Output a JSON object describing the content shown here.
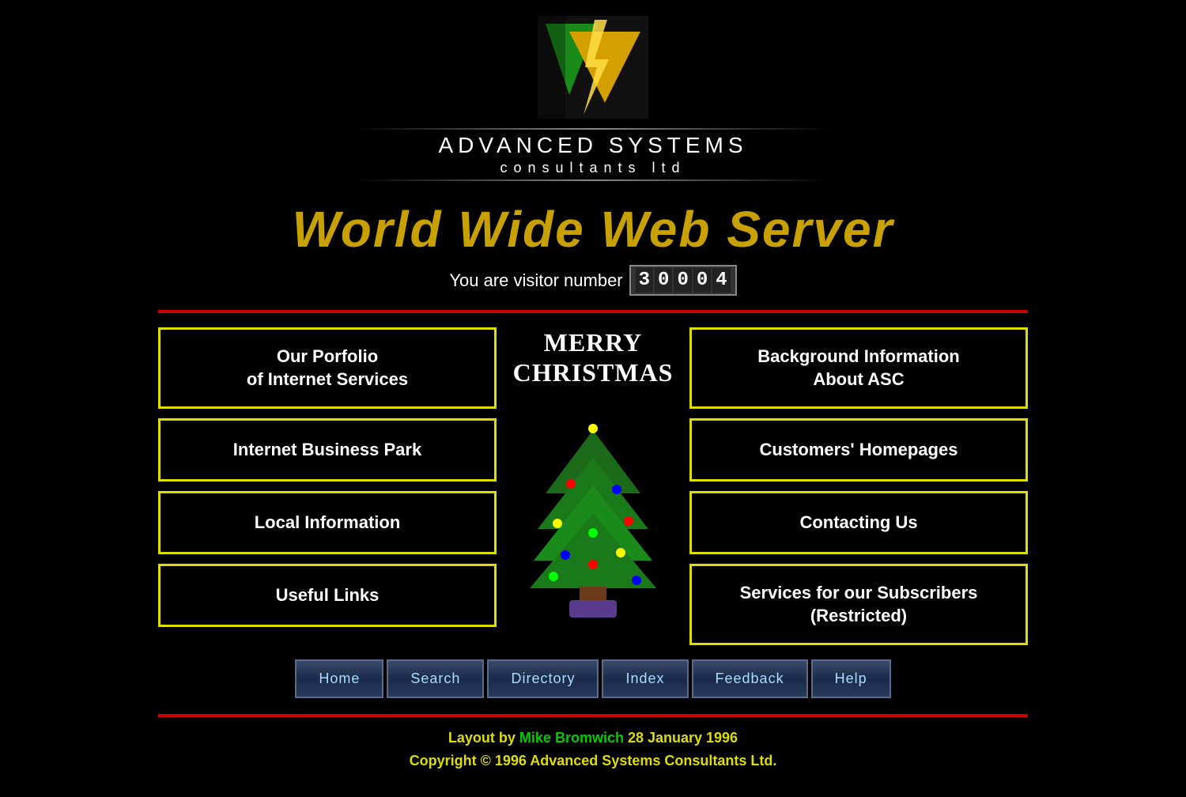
{
  "logo": {
    "company_name": "ADVANCED SYSTEMS",
    "company_sub": "consultants ltd"
  },
  "header": {
    "title": "World Wide Web Server",
    "visitor_label": "You are visitor number",
    "visitor_number": "30004"
  },
  "christmas": {
    "line1": "MERRY",
    "line2": "CHRISTMAS"
  },
  "nav_left": [
    {
      "id": "portfolio",
      "label": "Our Porfolio\nof Internet Services"
    },
    {
      "id": "business-park",
      "label": "Internet Business Park"
    },
    {
      "id": "local-info",
      "label": "Local Information"
    },
    {
      "id": "useful-links",
      "label": "Useful Links"
    }
  ],
  "nav_right": [
    {
      "id": "background",
      "label": "Background Information\nAbout ASC"
    },
    {
      "id": "customers",
      "label": "Customers' Homepages"
    },
    {
      "id": "contact",
      "label": "Contacting Us"
    },
    {
      "id": "subscribers",
      "label": "Services for our Subscribers\n(Restricted)"
    }
  ],
  "bottom_nav": [
    {
      "id": "home",
      "label": "Home"
    },
    {
      "id": "search",
      "label": "Search"
    },
    {
      "id": "directory",
      "label": "Directory"
    },
    {
      "id": "index",
      "label": "Index"
    },
    {
      "id": "feedback",
      "label": "Feedback"
    },
    {
      "id": "help",
      "label": "Help"
    }
  ],
  "footer": {
    "layout_by": "Layout by ",
    "author": "Mike Bromwich",
    "date": " 28 January 1996",
    "copyright": "Copyright © 1996 Advanced Systems Consultants Ltd."
  }
}
